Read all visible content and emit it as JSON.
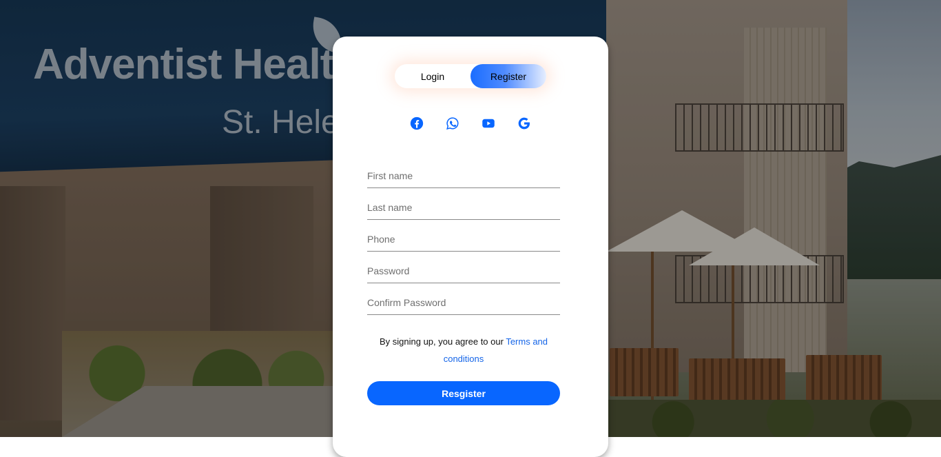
{
  "background": {
    "sign_main": "Adventist Healt",
    "sign_sub": "St. Hele"
  },
  "auth_toggle": {
    "login_label": "Login",
    "register_label": "Register",
    "active": "Register"
  },
  "social": [
    {
      "icon": "facebook-icon",
      "color": "#0866ff"
    },
    {
      "icon": "whatsapp-icon",
      "color": "#0866ff"
    },
    {
      "icon": "youtube-icon",
      "color": "#0866ff"
    },
    {
      "icon": "google-icon",
      "color": "#0866ff"
    }
  ],
  "form": {
    "first_name_placeholder": "First name",
    "last_name_placeholder": "Last name",
    "phone_placeholder": "Phone",
    "password_placeholder": "Password",
    "confirm_password_placeholder": "Confirm Password",
    "terms_text": "By signing up, you agree to our ",
    "terms_link": "Terms and conditions",
    "submit_label": "Resgister"
  },
  "colors": {
    "accent": "#0866ff",
    "link": "#1565e8"
  }
}
